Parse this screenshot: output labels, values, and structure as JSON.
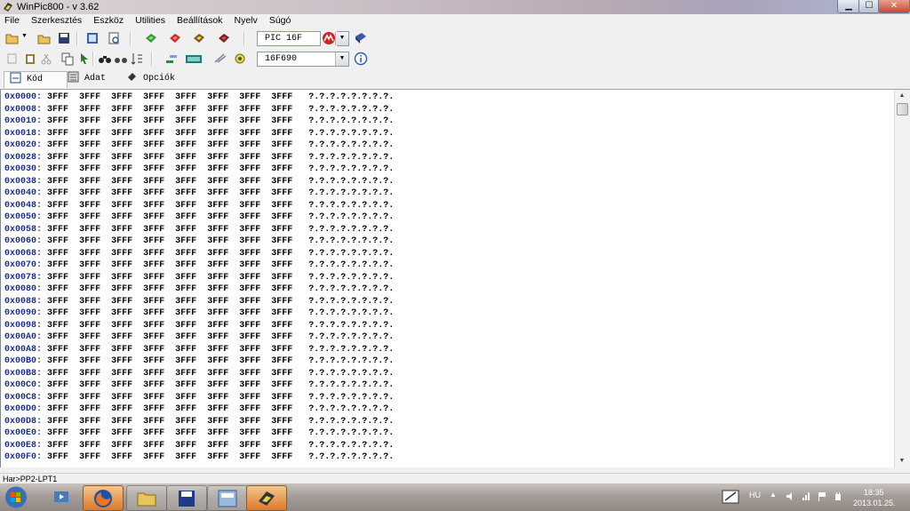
{
  "window": {
    "title": "WinPic800   -  v 3.62"
  },
  "menu": [
    "File",
    "Szerkesztés",
    "Eszköz",
    "Utilities",
    "Beállítások",
    "Nyelv",
    "Súgó"
  ],
  "toolbar1": {
    "device_family": "PIC 16F"
  },
  "toolbar2": {
    "device_model": "16F690"
  },
  "tabs": [
    {
      "label": "Kód",
      "icon": "code-icon",
      "active": true
    },
    {
      "label": "Adat",
      "icon": "data-icon",
      "active": false
    },
    {
      "label": "Opciók",
      "icon": "options-icon",
      "active": false
    }
  ],
  "hex": {
    "rows": [
      {
        "addr": "0x0000:",
        "words": [
          "3FFF",
          "3FFF",
          "3FFF",
          "3FFF",
          "3FFF",
          "3FFF",
          "3FFF",
          "3FFF"
        ],
        "ascii": "?.?.?.?.?.?.?.?."
      },
      {
        "addr": "0x0008:",
        "words": [
          "3FFF",
          "3FFF",
          "3FFF",
          "3FFF",
          "3FFF",
          "3FFF",
          "3FFF",
          "3FFF"
        ],
        "ascii": "?.?.?.?.?.?.?.?."
      },
      {
        "addr": "0x0010:",
        "words": [
          "3FFF",
          "3FFF",
          "3FFF",
          "3FFF",
          "3FFF",
          "3FFF",
          "3FFF",
          "3FFF"
        ],
        "ascii": "?.?.?.?.?.?.?.?."
      },
      {
        "addr": "0x0018:",
        "words": [
          "3FFF",
          "3FFF",
          "3FFF",
          "3FFF",
          "3FFF",
          "3FFF",
          "3FFF",
          "3FFF"
        ],
        "ascii": "?.?.?.?.?.?.?.?."
      },
      {
        "addr": "0x0020:",
        "words": [
          "3FFF",
          "3FFF",
          "3FFF",
          "3FFF",
          "3FFF",
          "3FFF",
          "3FFF",
          "3FFF"
        ],
        "ascii": "?.?.?.?.?.?.?.?."
      },
      {
        "addr": "0x0028:",
        "words": [
          "3FFF",
          "3FFF",
          "3FFF",
          "3FFF",
          "3FFF",
          "3FFF",
          "3FFF",
          "3FFF"
        ],
        "ascii": "?.?.?.?.?.?.?.?."
      },
      {
        "addr": "0x0030:",
        "words": [
          "3FFF",
          "3FFF",
          "3FFF",
          "3FFF",
          "3FFF",
          "3FFF",
          "3FFF",
          "3FFF"
        ],
        "ascii": "?.?.?.?.?.?.?.?."
      },
      {
        "addr": "0x0038:",
        "words": [
          "3FFF",
          "3FFF",
          "3FFF",
          "3FFF",
          "3FFF",
          "3FFF",
          "3FFF",
          "3FFF"
        ],
        "ascii": "?.?.?.?.?.?.?.?."
      },
      {
        "addr": "0x0040:",
        "words": [
          "3FFF",
          "3FFF",
          "3FFF",
          "3FFF",
          "3FFF",
          "3FFF",
          "3FFF",
          "3FFF"
        ],
        "ascii": "?.?.?.?.?.?.?.?."
      },
      {
        "addr": "0x0048:",
        "words": [
          "3FFF",
          "3FFF",
          "3FFF",
          "3FFF",
          "3FFF",
          "3FFF",
          "3FFF",
          "3FFF"
        ],
        "ascii": "?.?.?.?.?.?.?.?."
      },
      {
        "addr": "0x0050:",
        "words": [
          "3FFF",
          "3FFF",
          "3FFF",
          "3FFF",
          "3FFF",
          "3FFF",
          "3FFF",
          "3FFF"
        ],
        "ascii": "?.?.?.?.?.?.?.?."
      },
      {
        "addr": "0x0058:",
        "words": [
          "3FFF",
          "3FFF",
          "3FFF",
          "3FFF",
          "3FFF",
          "3FFF",
          "3FFF",
          "3FFF"
        ],
        "ascii": "?.?.?.?.?.?.?.?."
      },
      {
        "addr": "0x0060:",
        "words": [
          "3FFF",
          "3FFF",
          "3FFF",
          "3FFF",
          "3FFF",
          "3FFF",
          "3FFF",
          "3FFF"
        ],
        "ascii": "?.?.?.?.?.?.?.?."
      },
      {
        "addr": "0x0068:",
        "words": [
          "3FFF",
          "3FFF",
          "3FFF",
          "3FFF",
          "3FFF",
          "3FFF",
          "3FFF",
          "3FFF"
        ],
        "ascii": "?.?.?.?.?.?.?.?."
      },
      {
        "addr": "0x0070:",
        "words": [
          "3FFF",
          "3FFF",
          "3FFF",
          "3FFF",
          "3FFF",
          "3FFF",
          "3FFF",
          "3FFF"
        ],
        "ascii": "?.?.?.?.?.?.?.?."
      },
      {
        "addr": "0x0078:",
        "words": [
          "3FFF",
          "3FFF",
          "3FFF",
          "3FFF",
          "3FFF",
          "3FFF",
          "3FFF",
          "3FFF"
        ],
        "ascii": "?.?.?.?.?.?.?.?."
      },
      {
        "addr": "0x0080:",
        "words": [
          "3FFF",
          "3FFF",
          "3FFF",
          "3FFF",
          "3FFF",
          "3FFF",
          "3FFF",
          "3FFF"
        ],
        "ascii": "?.?.?.?.?.?.?.?."
      },
      {
        "addr": "0x0088:",
        "words": [
          "3FFF",
          "3FFF",
          "3FFF",
          "3FFF",
          "3FFF",
          "3FFF",
          "3FFF",
          "3FFF"
        ],
        "ascii": "?.?.?.?.?.?.?.?."
      },
      {
        "addr": "0x0090:",
        "words": [
          "3FFF",
          "3FFF",
          "3FFF",
          "3FFF",
          "3FFF",
          "3FFF",
          "3FFF",
          "3FFF"
        ],
        "ascii": "?.?.?.?.?.?.?.?."
      },
      {
        "addr": "0x0098:",
        "words": [
          "3FFF",
          "3FFF",
          "3FFF",
          "3FFF",
          "3FFF",
          "3FFF",
          "3FFF",
          "3FFF"
        ],
        "ascii": "?.?.?.?.?.?.?.?."
      },
      {
        "addr": "0x00A0:",
        "words": [
          "3FFF",
          "3FFF",
          "3FFF",
          "3FFF",
          "3FFF",
          "3FFF",
          "3FFF",
          "3FFF"
        ],
        "ascii": "?.?.?.?.?.?.?.?."
      },
      {
        "addr": "0x00A8:",
        "words": [
          "3FFF",
          "3FFF",
          "3FFF",
          "3FFF",
          "3FFF",
          "3FFF",
          "3FFF",
          "3FFF"
        ],
        "ascii": "?.?.?.?.?.?.?.?."
      },
      {
        "addr": "0x00B0:",
        "words": [
          "3FFF",
          "3FFF",
          "3FFF",
          "3FFF",
          "3FFF",
          "3FFF",
          "3FFF",
          "3FFF"
        ],
        "ascii": "?.?.?.?.?.?.?.?."
      },
      {
        "addr": "0x00B8:",
        "words": [
          "3FFF",
          "3FFF",
          "3FFF",
          "3FFF",
          "3FFF",
          "3FFF",
          "3FFF",
          "3FFF"
        ],
        "ascii": "?.?.?.?.?.?.?.?."
      },
      {
        "addr": "0x00C0:",
        "words": [
          "3FFF",
          "3FFF",
          "3FFF",
          "3FFF",
          "3FFF",
          "3FFF",
          "3FFF",
          "3FFF"
        ],
        "ascii": "?.?.?.?.?.?.?.?."
      },
      {
        "addr": "0x00C8:",
        "words": [
          "3FFF",
          "3FFF",
          "3FFF",
          "3FFF",
          "3FFF",
          "3FFF",
          "3FFF",
          "3FFF"
        ],
        "ascii": "?.?.?.?.?.?.?.?."
      },
      {
        "addr": "0x00D0:",
        "words": [
          "3FFF",
          "3FFF",
          "3FFF",
          "3FFF",
          "3FFF",
          "3FFF",
          "3FFF",
          "3FFF"
        ],
        "ascii": "?.?.?.?.?.?.?.?."
      },
      {
        "addr": "0x00D8:",
        "words": [
          "3FFF",
          "3FFF",
          "3FFF",
          "3FFF",
          "3FFF",
          "3FFF",
          "3FFF",
          "3FFF"
        ],
        "ascii": "?.?.?.?.?.?.?.?."
      },
      {
        "addr": "0x00E0:",
        "words": [
          "3FFF",
          "3FFF",
          "3FFF",
          "3FFF",
          "3FFF",
          "3FFF",
          "3FFF",
          "3FFF"
        ],
        "ascii": "?.?.?.?.?.?.?.?."
      },
      {
        "addr": "0x00E8:",
        "words": [
          "3FFF",
          "3FFF",
          "3FFF",
          "3FFF",
          "3FFF",
          "3FFF",
          "3FFF",
          "3FFF"
        ],
        "ascii": "?.?.?.?.?.?.?.?."
      },
      {
        "addr": "0x00F0:",
        "words": [
          "3FFF",
          "3FFF",
          "3FFF",
          "3FFF",
          "3FFF",
          "3FFF",
          "3FFF",
          "3FFF"
        ],
        "ascii": "?.?.?.?.?.?.?.?."
      }
    ]
  },
  "status": {
    "text": "Har>PP2-LPT1"
  },
  "tray": {
    "language": "HU",
    "time": "18:35",
    "date": "2013.01.25."
  },
  "colors": {
    "address": "#1b2f8a",
    "taskbar": "#a49d99",
    "close_button": "#c44a30"
  }
}
